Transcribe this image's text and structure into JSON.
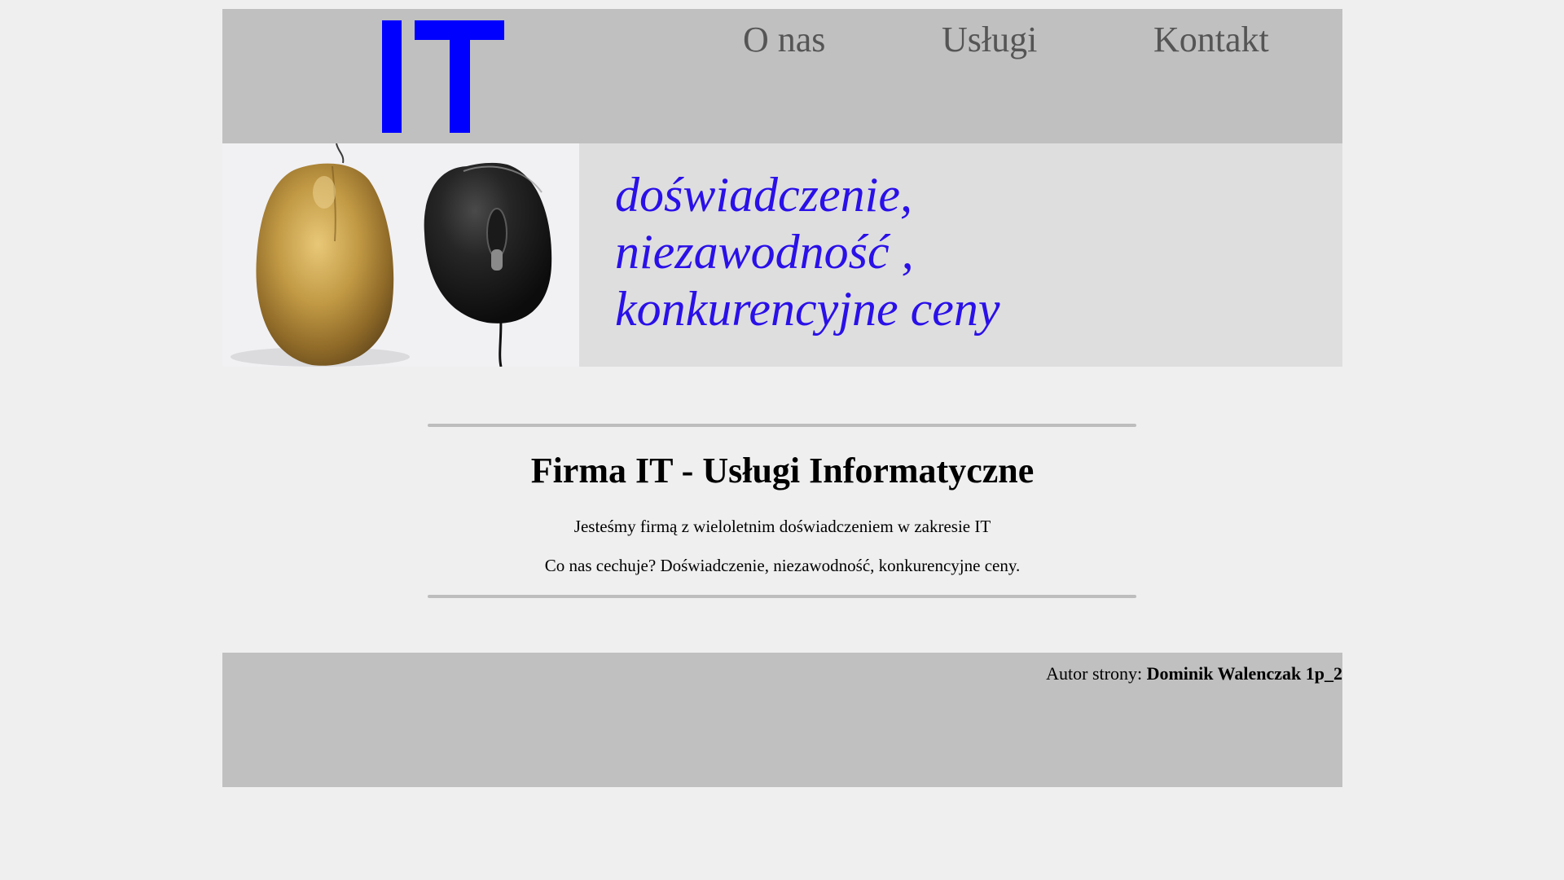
{
  "header": {
    "logo_text": "IT",
    "nav": {
      "about": "O nas",
      "services": "Usługi",
      "contact": "Kontakt"
    }
  },
  "banner": {
    "slogan_lines": [
      "doświadczenie,",
      "niezawodność ,",
      "konkurencyjne ceny"
    ]
  },
  "main": {
    "title": "Firma IT - Usługi Informatyczne",
    "paragraph_1": "Jesteśmy firmą z wieloletnim doświadczeniem w zakresie IT",
    "paragraph_2": "Co nas cechuje? Doświadczenie, niezawodność, konkurencyjne ceny."
  },
  "footer": {
    "author_label": "Autor strony: ",
    "author_name": "Dominik Walenczak 1p_2"
  },
  "colors": {
    "page_background": "#efefef",
    "header_footer_background": "#c0c0c0",
    "banner_background": "#dedede",
    "logo_blue": "#0000ff",
    "slogan_blue": "#2a10e8",
    "nav_text": "#555555"
  },
  "icons": {
    "banner_image": "gold-and-black-computer-mice"
  }
}
